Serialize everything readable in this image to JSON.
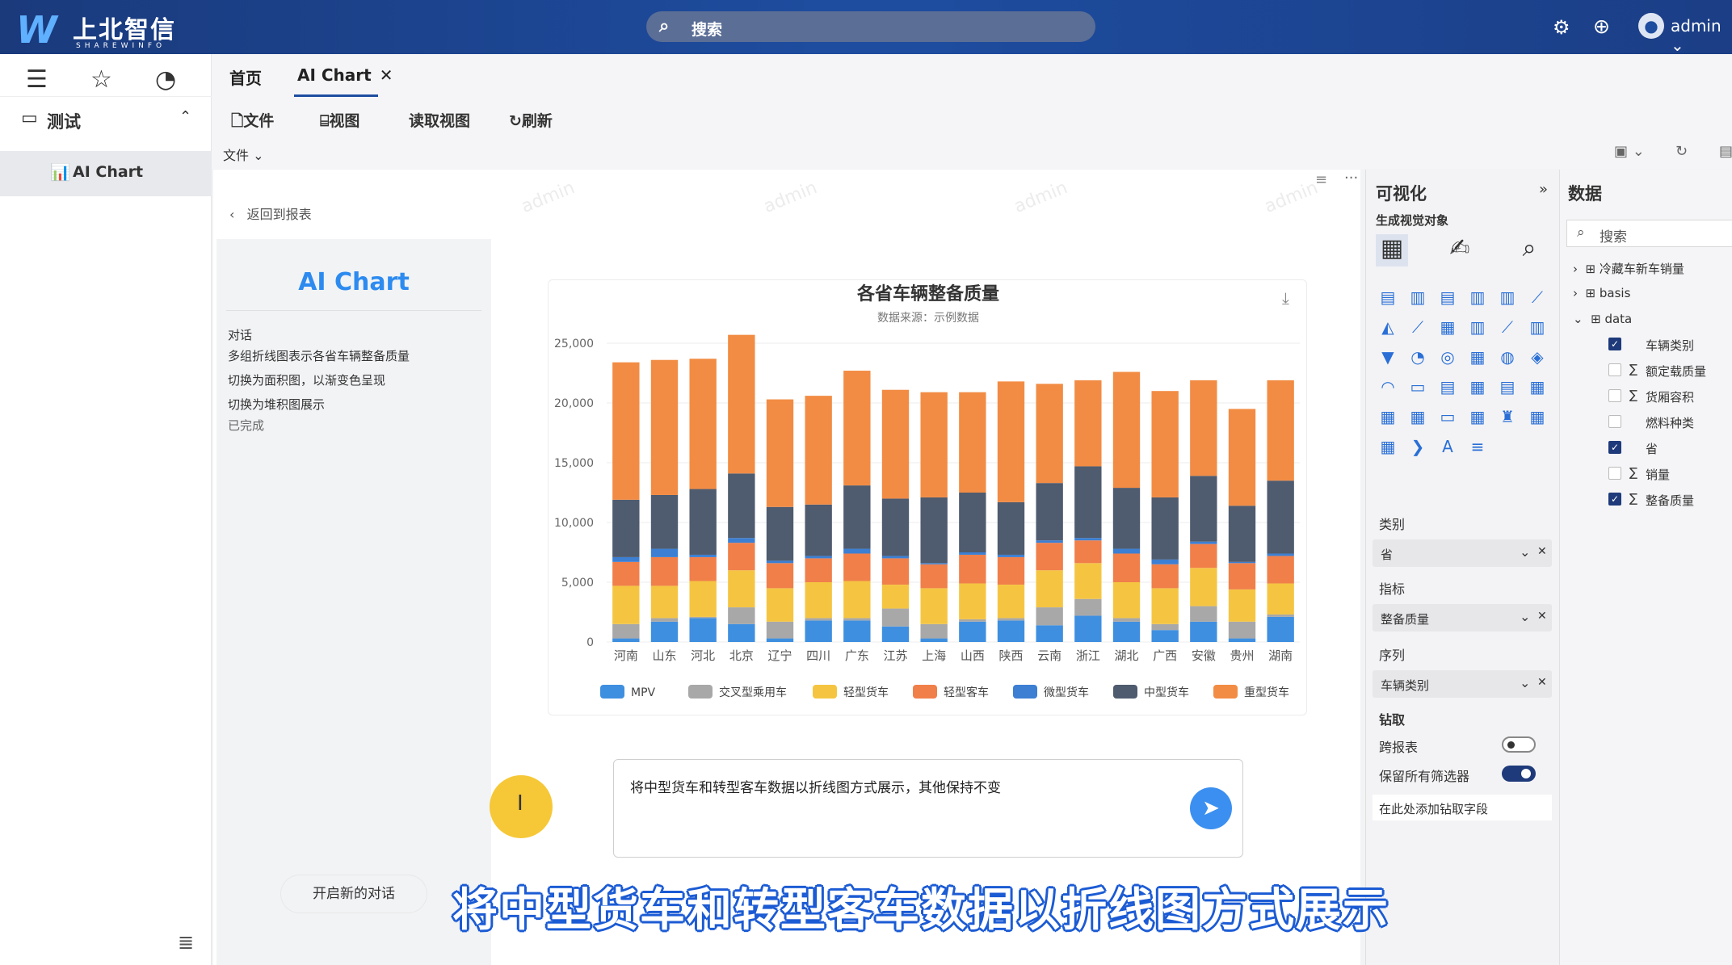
{
  "app": {
    "logo_cn": "上北智信",
    "logo_en": "SHAREWINFO",
    "search_label": "搜索",
    "user": "admin"
  },
  "sidebar": {
    "folder": "测试",
    "item": "AI Chart"
  },
  "tabs": [
    {
      "label": "首页"
    },
    {
      "label": "AI Chart"
    }
  ],
  "toolbar": {
    "file": "文件",
    "view": "视图",
    "read_view": "读取视图",
    "refresh": "刷新",
    "file_menu": "文件"
  },
  "canvas": {
    "back": "返回到报表",
    "watermark": "admin"
  },
  "conversation": {
    "title": "AI Chart",
    "lines": [
      "对话",
      "多组折线图表示各省车辆整备质量",
      "切换为面积图，以渐变色呈现",
      "切换为堆积图展示",
      "已完成"
    ],
    "new_button": "开启新的对话"
  },
  "input": {
    "text": "将中型货车和转型客车数据以折线图方式展示，其他保持不变"
  },
  "subtitle": "将中型货车和转型客车数据以折线图方式展示",
  "viz": {
    "title": "可视化",
    "subtitle": "生成视觉对象",
    "category_label": "类别",
    "category_value": "省",
    "metric_label": "指标",
    "metric_value": "整备质量",
    "series_label": "序列",
    "series_value": "车辆类别",
    "drill_label": "钻取",
    "cross_report": "跨报表",
    "keep_filters": "保留所有筛选器",
    "drill_add": "在此处添加钻取字段"
  },
  "data": {
    "title": "数据",
    "search": "搜索",
    "tables": [
      {
        "name": "冷藏车新车销量",
        "expanded": false
      },
      {
        "name": "basis",
        "expanded": false
      },
      {
        "name": "data",
        "expanded": true
      }
    ],
    "fields": [
      {
        "name": "车辆类别",
        "checked": true,
        "sigma": false
      },
      {
        "name": "额定载质量",
        "checked": false,
        "sigma": true
      },
      {
        "name": "货厢容积",
        "checked": false,
        "sigma": true
      },
      {
        "name": "燃料种类",
        "checked": false,
        "sigma": false
      },
      {
        "name": "省",
        "checked": true,
        "sigma": false
      },
      {
        "name": "销量",
        "checked": false,
        "sigma": true
      },
      {
        "name": "整备质量",
        "checked": true,
        "sigma": true
      }
    ]
  },
  "chart_data": {
    "type": "bar",
    "stacked": true,
    "title": "各省车辆整备质量",
    "subtitle": "数据来源：示例数据",
    "ylim": [
      0,
      25000
    ],
    "yticks": [
      "0",
      "5,000",
      "10,000",
      "15,000",
      "20,000",
      "25,000"
    ],
    "categories": [
      "河南",
      "山东",
      "河北",
      "北京",
      "辽宁",
      "四川",
      "广东",
      "江苏",
      "上海",
      "山西",
      "陕西",
      "云南",
      "浙江",
      "湖北",
      "广西",
      "安徽",
      "贵州",
      "湖南"
    ],
    "series": [
      {
        "name": "MPV",
        "color": "#3f8fe0",
        "values": [
          300,
          1700,
          2000,
          1500,
          300,
          1800,
          1800,
          1300,
          300,
          1700,
          1800,
          1400,
          2200,
          1700,
          1000,
          1700,
          300,
          2100
        ]
      },
      {
        "name": "交叉型乘用车",
        "color": "#a8a8a8",
        "values": [
          1200,
          300,
          100,
          1400,
          1400,
          200,
          200,
          1500,
          1200,
          200,
          200,
          1500,
          1400,
          300,
          500,
          1300,
          1400,
          200
        ]
      },
      {
        "name": "轻型货车",
        "color": "#f5c542",
        "values": [
          3200,
          2700,
          3000,
          3100,
          2800,
          3000,
          3100,
          2000,
          3000,
          3000,
          2800,
          3100,
          3000,
          3000,
          3000,
          3200,
          2700,
          2600
        ]
      },
      {
        "name": "轻型客车",
        "color": "#f07f4a",
        "values": [
          2000,
          2400,
          2000,
          2300,
          2100,
          2000,
          2300,
          2200,
          2000,
          2400,
          2300,
          2300,
          1900,
          2400,
          2000,
          2000,
          2200,
          2300
        ]
      },
      {
        "name": "微型货车",
        "color": "#3c7fd3",
        "values": [
          400,
          700,
          200,
          400,
          200,
          200,
          400,
          200,
          100,
          200,
          200,
          200,
          200,
          400,
          400,
          200,
          100,
          200
        ]
      },
      {
        "name": "中型货车",
        "color": "#4f5b6e",
        "values": [
          4800,
          4500,
          5500,
          5400,
          4500,
          4300,
          5300,
          4800,
          5500,
          5000,
          4400,
          4800,
          6000,
          5100,
          5200,
          5500,
          4700,
          6100
        ]
      },
      {
        "name": "重型货车",
        "color": "#f28c44",
        "values": [
          11500,
          11300,
          10900,
          11600,
          9000,
          9100,
          9600,
          9100,
          8800,
          8400,
          10100,
          8300,
          7200,
          9700,
          8900,
          8000,
          8100,
          8400
        ]
      }
    ],
    "legend_position": "bottom"
  }
}
